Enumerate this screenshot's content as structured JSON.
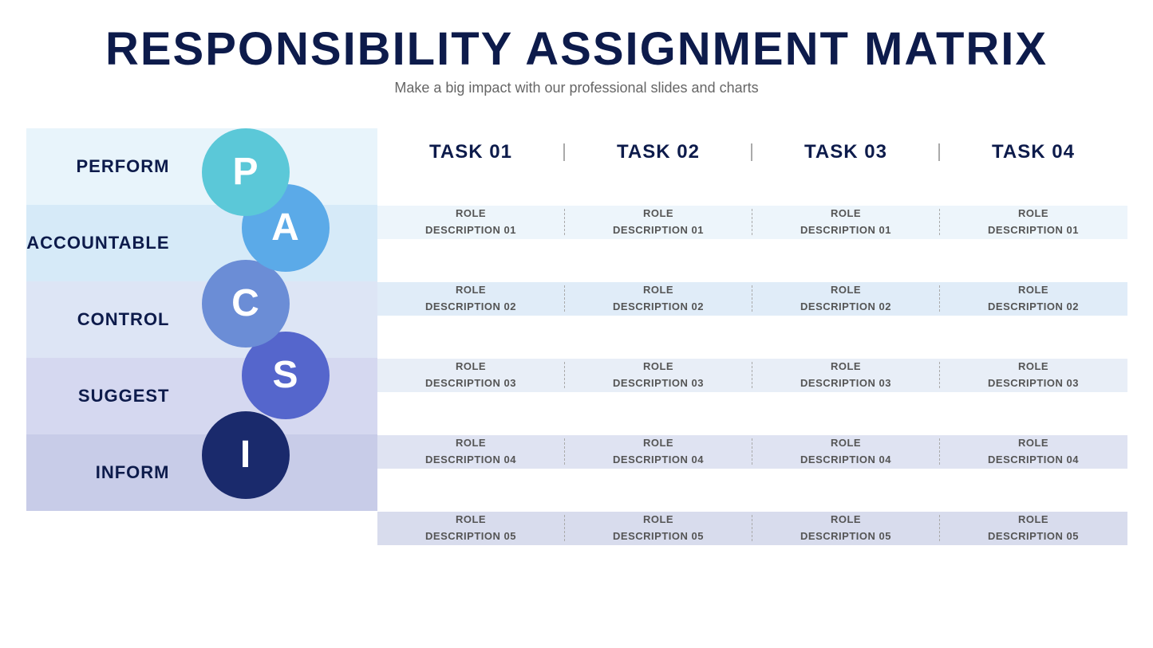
{
  "header": {
    "title": "RESPONSIBILITY ASSIGNMENT MATRIX",
    "subtitle": "Make a big impact with our professional slides and charts"
  },
  "tasks": [
    {
      "label": "TASK 01"
    },
    {
      "label": "TASK 02"
    },
    {
      "label": "TASK 03"
    },
    {
      "label": "TASK 04"
    }
  ],
  "rows": [
    {
      "label": "PERFORM",
      "circle_letter": "P",
      "circle_class": "circle-p",
      "cells": [
        "ROLE\nDESCRIPTION 01",
        "ROLE\nDESCRIPTION 01",
        "ROLE\nDESCRIPTION 01",
        "ROLE\nDESCRIPTION 01"
      ]
    },
    {
      "label": "ACCOUNTABLE",
      "circle_letter": "A",
      "circle_class": "circle-a",
      "cells": [
        "ROLE\nDESCRIPTION 02",
        "ROLE\nDESCRIPTION 02",
        "ROLE\nDESCRIPTION 02",
        "ROLE\nDESCRIPTION 02"
      ]
    },
    {
      "label": "CONTROL",
      "circle_letter": "C",
      "circle_class": "circle-c",
      "cells": [
        "ROLE\nDESCRIPTION 03",
        "ROLE\nDESCRIPTION 03",
        "ROLE\nDESCRIPTION 03",
        "ROLE\nDESCRIPTION 03"
      ]
    },
    {
      "label": "SUGGEST",
      "circle_letter": "S",
      "circle_class": "circle-s",
      "cells": [
        "ROLE\nDESCRIPTION 04",
        "ROLE\nDESCRIPTION 04",
        "ROLE\nDESCRIPTION 04",
        "ROLE\nDESCRIPTION 04"
      ]
    },
    {
      "label": "INFORM",
      "circle_letter": "I",
      "circle_class": "circle-i",
      "cells": [
        "ROLE\nDESCRIPTION 05",
        "ROLE\nDESCRIPTION 05",
        "ROLE\nDESCRIPTION 05",
        "ROLE\nDESCRIPTION 05"
      ]
    }
  ]
}
